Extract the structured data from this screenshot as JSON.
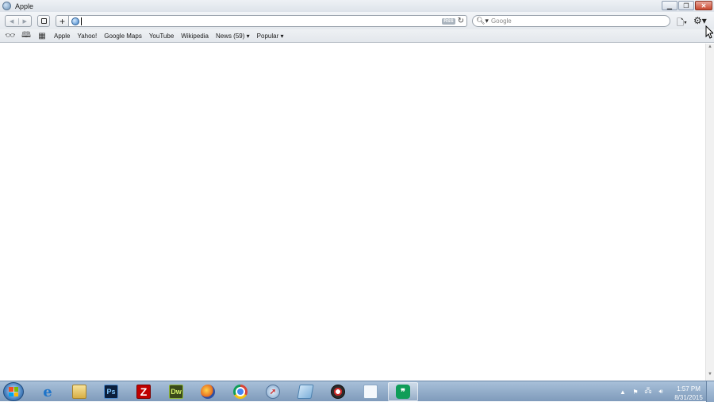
{
  "window": {
    "title": "Apple"
  },
  "toolbar": {
    "back_icon": "back-arrow",
    "forward_icon": "forward-arrow",
    "address_value": "",
    "rss_label": "RSS",
    "search_placeholder": "Google"
  },
  "bookmarks": {
    "items": [
      {
        "label": "Apple"
      },
      {
        "label": "Yahoo!"
      },
      {
        "label": "Google Maps"
      },
      {
        "label": "YouTube"
      },
      {
        "label": "Wikipedia"
      },
      {
        "label": "News (59) ▾"
      },
      {
        "label": "Popular ▾"
      }
    ]
  },
  "taskbar": {
    "apps": [
      "internet-explorer",
      "windows-explorer",
      "photoshop",
      "filezilla",
      "dreamweaver",
      "firefox",
      "chrome",
      "safari",
      "app-blue",
      "pokeball-app",
      "document-app",
      "hangouts"
    ],
    "active_app": "hangouts",
    "ps_label": "Ps",
    "dw_label": "Dw",
    "fz_label": "Z",
    "clock_time": "1:57 PM",
    "clock_date": "8/31/2015"
  },
  "colors": {
    "taskbar": "#8ba6c4",
    "chrome_toolbar": "#e8ecf0",
    "close_button": "#c9482f"
  }
}
